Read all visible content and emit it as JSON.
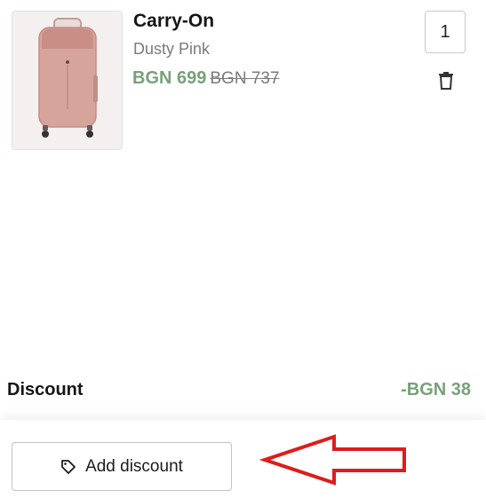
{
  "product": {
    "title": "Carry-On",
    "variant": "Dusty Pink",
    "price_current": "BGN 699",
    "price_original": "BGN 737",
    "quantity": "1",
    "image_icon": "pink-suitcase-image",
    "delete_icon": "trash-icon"
  },
  "summary": {
    "discount_label": "Discount",
    "discount_amount": "-BGN 38"
  },
  "actions": {
    "add_discount_label": "Add discount",
    "add_discount_icon": "tag-icon"
  },
  "annotation": {
    "arrow_color": "#e01b1b",
    "arrow_direction": "left"
  },
  "colors": {
    "price_accent": "#78a178",
    "text_muted": "#7b7b7b"
  }
}
